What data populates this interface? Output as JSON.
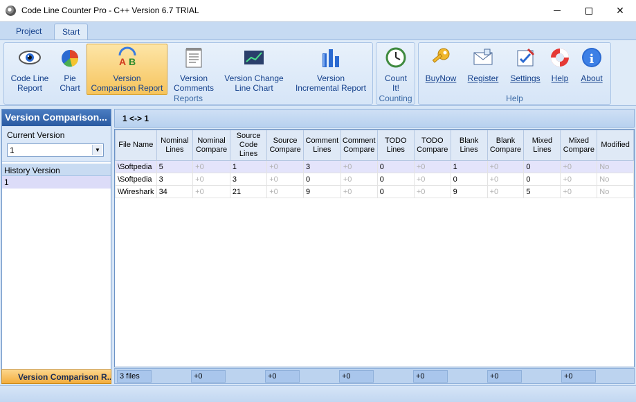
{
  "window": {
    "title": "Code Line Counter Pro - C++ Version 6.7 TRIAL",
    "minimize": "",
    "maximize": "",
    "close": "✕"
  },
  "tabs": [
    {
      "label": "Project"
    },
    {
      "label": "Start",
      "active": true
    }
  ],
  "ribbon": {
    "groups": {
      "reports": "Reports",
      "counting": "Counting",
      "help": "Help"
    },
    "buttons": {
      "code_line_report": [
        "Code Line",
        "Report"
      ],
      "pie_chart": [
        "Pie",
        "Chart"
      ],
      "version_comparison_report": [
        "Version",
        "Comparison Report"
      ],
      "version_comments": [
        "Version",
        "Comments"
      ],
      "version_change_line_chart": [
        "Version Change",
        "Line Chart"
      ],
      "version_incremental_report": [
        "Version",
        "Incremental Report"
      ],
      "count_it": [
        "Count",
        "It!"
      ],
      "buy_now": "BuyNow",
      "register": "Register",
      "settings": "Settings",
      "help": "Help",
      "about": "About"
    }
  },
  "left_panel": {
    "title": "Version Comparison...",
    "current_version_label": "Current Version",
    "current_version_value": "1",
    "history_version_label": "History Version",
    "history_items": [
      "1"
    ],
    "footer": "Version Comparison R..."
  },
  "main": {
    "header": "1 <-> 1",
    "columns": [
      "File Name",
      "Nominal Lines",
      "Nominal Compare",
      "Source Code Lines",
      "Source Compare",
      "Comment Lines",
      "Comment Compare",
      "TODO Lines",
      "TODO Compare",
      "Blank Lines",
      "Blank Compare",
      "Mixed Lines",
      "Mixed Compare",
      "Modified"
    ],
    "rows": [
      [
        "\\Softpedia",
        "5",
        "+0",
        "1",
        "+0",
        "3",
        "+0",
        "0",
        "+0",
        "1",
        "+0",
        "0",
        "+0",
        "No"
      ],
      [
        "\\Softpedia",
        "3",
        "+0",
        "3",
        "+0",
        "0",
        "+0",
        "0",
        "+0",
        "0",
        "+0",
        "0",
        "+0",
        "No"
      ],
      [
        "\\Wireshark",
        "34",
        "+0",
        "21",
        "+0",
        "9",
        "+0",
        "0",
        "+0",
        "9",
        "+0",
        "5",
        "+0",
        "No"
      ]
    ],
    "footer": {
      "files": "3 files",
      "totals": [
        "+0",
        "+0",
        "+0",
        "+0",
        "+0",
        "+0"
      ]
    }
  },
  "colors": {
    "accent": "#15418c",
    "active_button": "#f6c45d",
    "selected_row": "#e4e4fb"
  }
}
